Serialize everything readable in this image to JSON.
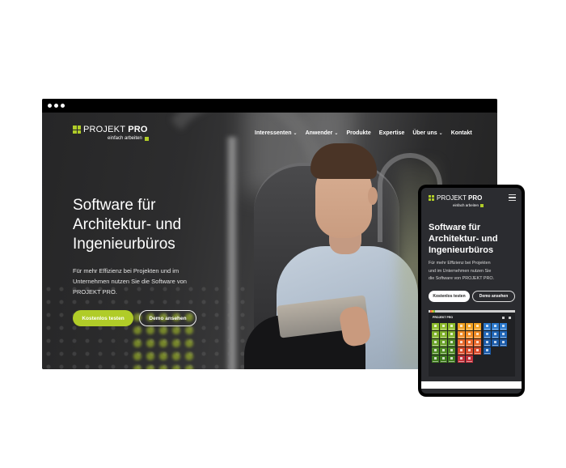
{
  "desktop": {
    "window_dots": 3,
    "logo": {
      "brand_light": "PROJEKT",
      "brand_bold": "PRO",
      "tagline": "einfach arbeiten"
    },
    "nav": [
      {
        "label": "Interessenten",
        "dropdown": true,
        "chevron": "⌄"
      },
      {
        "label": "Anwender",
        "dropdown": true,
        "chevron": "⌄"
      },
      {
        "label": "Produkte",
        "dropdown": false
      },
      {
        "label": "Expertise",
        "dropdown": false
      },
      {
        "label": "Über uns",
        "dropdown": true,
        "chevron": "⌄"
      },
      {
        "label": "Kontakt",
        "dropdown": false
      }
    ],
    "hero": {
      "title_lines": [
        "Software für",
        "Architektur- und",
        "Ingenieurbüros"
      ],
      "subtitle_lines": [
        "Für mehr Effizienz bei Projekten und im",
        "Unternehmen nutzen Sie die Software von",
        "PROJEKT PRO."
      ],
      "primary_button": "Kostenlos testen",
      "secondary_button": "Demo ansehen"
    }
  },
  "mobile": {
    "logo": {
      "brand_light": "PROJEKT",
      "brand_bold": "PRO",
      "tagline": "einfach arbeiten"
    },
    "menu_icon": "hamburger-icon",
    "hero": {
      "title_lines": [
        "Software für",
        "Architektur- und",
        "Ingenieurbüros"
      ],
      "subtitle_lines": [
        "Für mehr Effizienz bei Projekten",
        "und im Unternehmen nutzen Sie",
        "die Software von PROJEKT PRO."
      ],
      "primary_button": "Kostenlos testen",
      "secondary_button": "Demo ansehen"
    },
    "app_preview": {
      "logo": "PROJEKT PRO",
      "tile_groups": [
        {
          "name": "green",
          "colors": [
            "#8dbb2b",
            "#8dbb2b",
            "#8dbb2b",
            "#7fb02a",
            "#7fb02a",
            "#7fb02a",
            "#6aa12a",
            "#6aa12a",
            "#4f8a24",
            "#4f8a24",
            "#4f8a24",
            "#4f8a24",
            "#3f7a1e",
            "#3f7a1e",
            "#3f7a1e"
          ]
        },
        {
          "name": "orange-red",
          "colors": [
            "#f0a020",
            "#f0a020",
            "#f0a020",
            "#ef8a22",
            "#ef8a22",
            "#ef8a22",
            "#e8682a",
            "#e8682a",
            "#e8682a",
            "#d84a2a",
            "#d84a2a",
            "#d84a2a",
            "#c0303a",
            "#c0303a"
          ]
        },
        {
          "name": "blue",
          "colors": [
            "#2a78cc",
            "#2a78cc",
            "#2a78cc",
            "#1f66b8",
            "#1f66b8",
            "#1f66b8",
            "#1a5aa8",
            "#1a5aa8",
            "#1a5aa8",
            "#1a5aa8"
          ]
        }
      ]
    }
  },
  "colors": {
    "accent_green": "#b0cc28",
    "dark_bg": "#2b2c30"
  }
}
